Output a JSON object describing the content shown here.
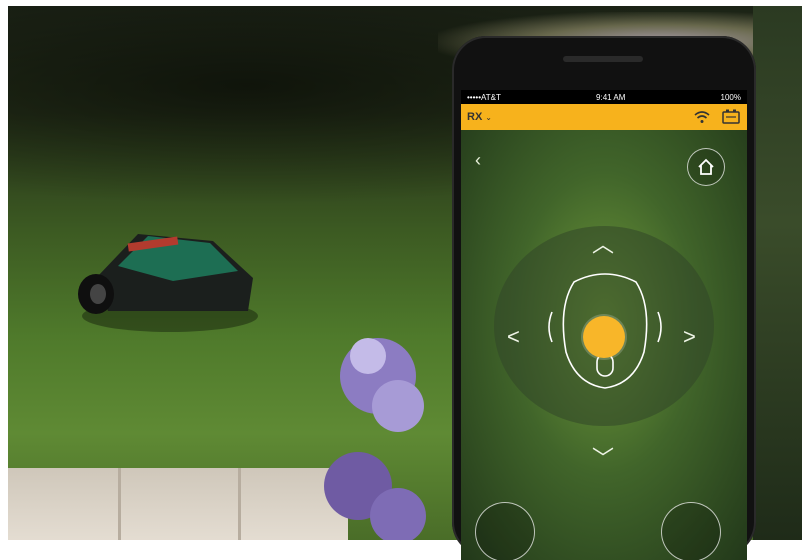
{
  "statusbar": {
    "carrier": "•••••AT&T",
    "time": "9:41 AM",
    "battery": "100%"
  },
  "appbar": {
    "model": "RX",
    "model_chevron": "⌄",
    "accent_color": "#f7b21c"
  },
  "controls": {
    "back_icon": "chevron-left-icon",
    "home_icon": "home-icon",
    "up": "︿",
    "down": "﹀",
    "left": "<",
    "right": ">",
    "joystick_color": "#f8b629"
  }
}
